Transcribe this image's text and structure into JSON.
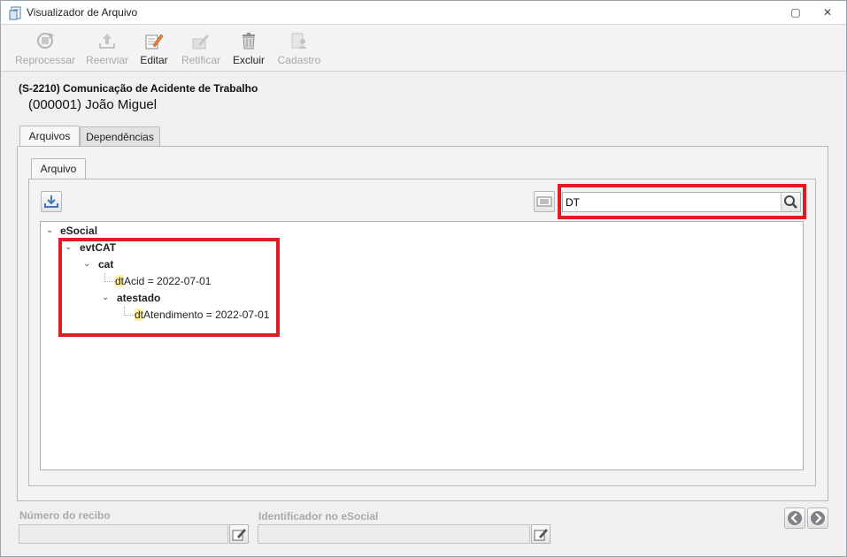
{
  "window": {
    "title": "Visualizador de Arquivo",
    "restore_glyph": "▢",
    "close_glyph": "✕"
  },
  "toolbar": {
    "items": [
      {
        "label": "Reprocessar",
        "icon": "reprocess-icon",
        "enabled": false
      },
      {
        "label": "Reenviar",
        "icon": "resend-icon",
        "enabled": false
      },
      {
        "label": "Editar",
        "icon": "edit-icon",
        "enabled": true
      },
      {
        "label": "Retificar",
        "icon": "rectify-icon",
        "enabled": false
      },
      {
        "label": "Excluir",
        "icon": "trash-icon",
        "enabled": true
      },
      {
        "label": "Cadastro",
        "icon": "register-icon",
        "enabled": false
      }
    ]
  },
  "header": {
    "event": "(S-2210) Comunicação de Acidente de Trabalho",
    "person": "(000001) João Miguel"
  },
  "tabs": {
    "outer": [
      {
        "label": "Arquivos",
        "active": true
      },
      {
        "label": "Dependências",
        "active": false
      }
    ],
    "inner": [
      {
        "label": "Arquivo",
        "active": true
      }
    ]
  },
  "search": {
    "value": "DT",
    "icon": "search-icon"
  },
  "tree": {
    "root": "eSocial",
    "nodes": [
      {
        "label": "evtCAT"
      },
      {
        "label": "cat"
      },
      {
        "highlight": "dt",
        "rest": "Acid = 2022-07-01"
      },
      {
        "label": "atestado"
      },
      {
        "highlight": "dt",
        "rest": "Atendimento = 2022-07-01"
      }
    ]
  },
  "footer": {
    "receipt_label": "Número do recibo",
    "receipt_value": "",
    "esocial_id_label": "Identificador no eSocial",
    "esocial_id_value": ""
  },
  "colors": {
    "annotation_red": "#e01b24",
    "search_highlight": "#fff0a8"
  }
}
